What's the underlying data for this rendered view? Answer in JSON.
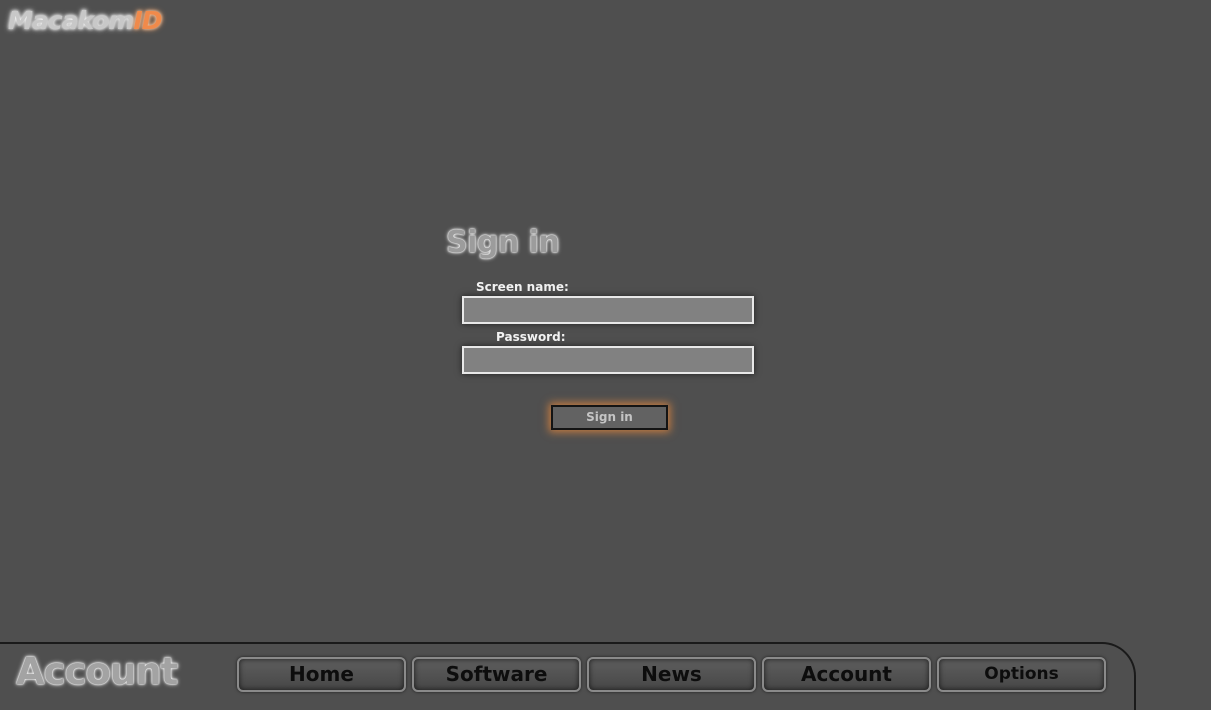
{
  "brand": {
    "main": "Macakom",
    "accent": "ID",
    "accent_color": "#f08a4b"
  },
  "signin": {
    "title": "Sign in",
    "screen_name_label": "Screen name:",
    "screen_name_value": "",
    "password_label": "Password:",
    "password_value": "",
    "button_label": "Sign in"
  },
  "footer": {
    "section_title": "Account",
    "nav": [
      {
        "label": "Home"
      },
      {
        "label": "Software"
      },
      {
        "label": "News"
      },
      {
        "label": "Account"
      },
      {
        "label": "Options"
      }
    ]
  },
  "colors": {
    "background": "#4f4f4f",
    "input_fill": "#818181",
    "button_glow": "#f08c3c"
  }
}
